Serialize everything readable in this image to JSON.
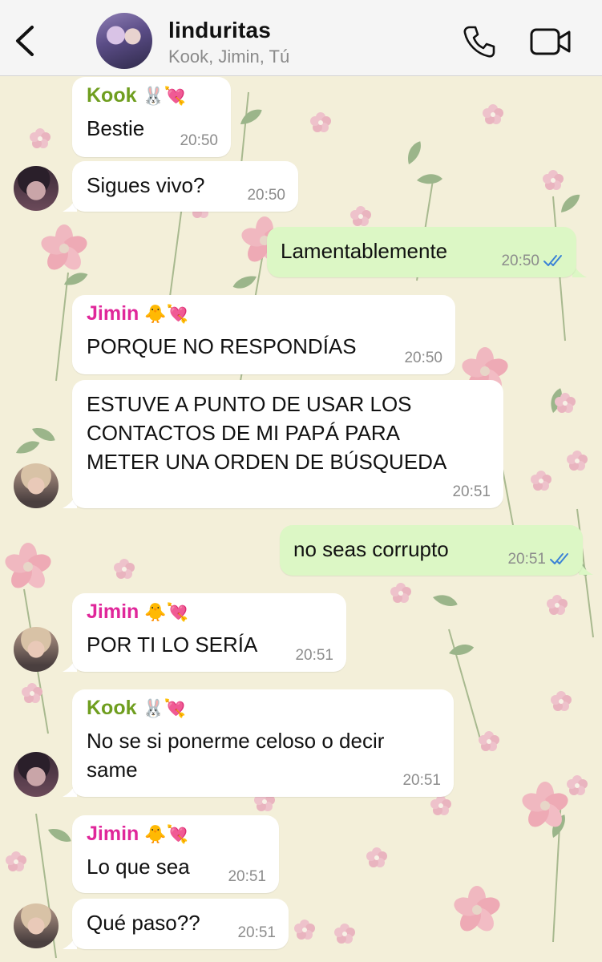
{
  "header": {
    "title": "linduritas",
    "members": "Kook, Jimin, Tú"
  },
  "colors": {
    "kook_name": "#6f9e1f",
    "jimin_name": "#e0279a",
    "outgoing_bubble": "#dcf7c5",
    "incoming_bubble": "#ffffff",
    "read_check": "#3b82d6"
  },
  "messages": [
    {
      "sender": "Kook",
      "sender_emoji": "🐰💘",
      "text": "Bestie",
      "time": "20:50",
      "direction": "in"
    },
    {
      "text": "Sigues vivo?",
      "time": "20:50",
      "direction": "in"
    },
    {
      "text": "Lamentablemente",
      "time": "20:50",
      "direction": "out",
      "status": "read"
    },
    {
      "sender": "Jimin",
      "sender_emoji": "🐥💘",
      "text": "PORQUE NO RESPONDÍAS",
      "time": "20:50",
      "direction": "in"
    },
    {
      "text_lines": [
        "ESTUVE A PUNTO DE USAR LOS",
        "CONTACTOS DE MI PAPÁ PARA",
        "METER UNA ORDEN DE BÚSQUEDA"
      ],
      "time": "20:51",
      "direction": "in"
    },
    {
      "text": "no seas corrupto",
      "time": "20:51",
      "direction": "out",
      "status": "read"
    },
    {
      "sender": "Jimin",
      "sender_emoji": "🐥💘",
      "text": "POR TI LO SERÍA",
      "time": "20:51",
      "direction": "in"
    },
    {
      "sender": "Kook",
      "sender_emoji": "🐰💘",
      "text_lines": [
        "No se si ponerme celoso o decir",
        "same"
      ],
      "time": "20:51",
      "direction": "in"
    },
    {
      "sender": "Jimin",
      "sender_emoji": "🐥💘",
      "text": "Lo que sea",
      "time": "20:51",
      "direction": "in"
    },
    {
      "text": "Qué paso??",
      "time": "20:51",
      "direction": "in"
    }
  ]
}
